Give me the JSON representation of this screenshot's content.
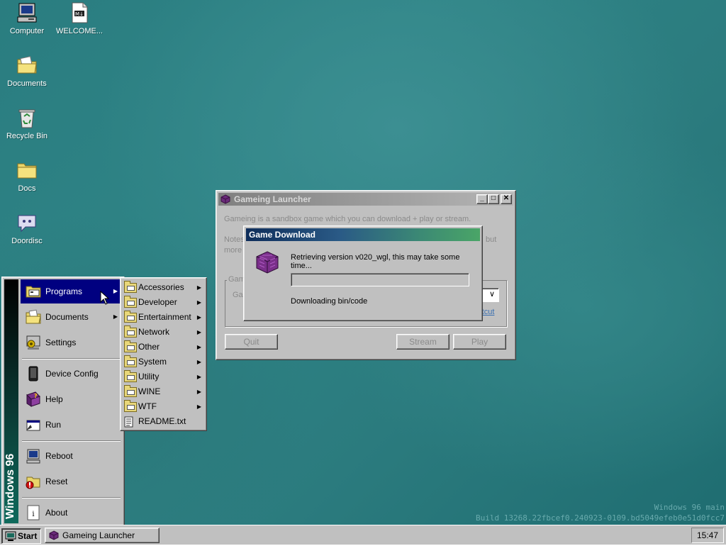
{
  "desktop": {
    "icons": [
      {
        "label": "Computer",
        "icon": "computer-icon"
      },
      {
        "label": "WELCOME...",
        "icon": "markdown-file-icon"
      },
      {
        "label": "Documents",
        "icon": "documents-folder-icon"
      },
      {
        "label": "Recycle Bin",
        "icon": "recycle-bin-icon"
      },
      {
        "label": "Docs",
        "icon": "folder-icon"
      },
      {
        "label": "Doordisc",
        "icon": "doordisc-icon"
      }
    ],
    "watermark": {
      "line1": "Windows 96 main",
      "line2": "Build 13268.22fbcef0.240923-0109.bd5049efeb0e51d0fcc7"
    }
  },
  "launcher": {
    "title": "Gameing Launcher",
    "description": "Gameing is a sandbox game which you can download + play or stream.",
    "notes_prefix": "Notes",
    "notes_suffix": "but",
    "more_prefix": "more",
    "group_label": "Game",
    "version_label": "Ga",
    "shortcut_link": "rtcut",
    "buttons": {
      "quit": "Quit",
      "stream": "Stream",
      "play": "Play"
    }
  },
  "download_dialog": {
    "title": "Game Download",
    "message": "Retrieving version v020_wgl, this may take some time...",
    "status": "Downloading bin/code",
    "progress": 0
  },
  "start_menu": {
    "side_label": "Windows 96",
    "items": [
      {
        "label": "Programs",
        "icon": "programs-icon",
        "submenu": true
      },
      {
        "label": "Documents",
        "icon": "documents-icon",
        "submenu": true
      },
      {
        "label": "Settings",
        "icon": "settings-icon",
        "submenu": false
      },
      {
        "label": "Device Config",
        "icon": "device-config-icon",
        "submenu": false
      },
      {
        "label": "Help",
        "icon": "help-icon",
        "submenu": false
      },
      {
        "label": "Run",
        "icon": "run-icon",
        "submenu": false
      },
      {
        "label": "Reboot",
        "icon": "reboot-icon",
        "submenu": false
      },
      {
        "label": "Reset",
        "icon": "reset-icon",
        "submenu": false
      },
      {
        "label": "About",
        "icon": "about-icon",
        "submenu": false
      }
    ]
  },
  "programs_menu": {
    "items": [
      {
        "label": "Accessories",
        "submenu": true
      },
      {
        "label": "Developer",
        "submenu": true
      },
      {
        "label": "Entertainment",
        "submenu": true
      },
      {
        "label": "Network",
        "submenu": true
      },
      {
        "label": "Other",
        "submenu": true
      },
      {
        "label": "System",
        "submenu": true
      },
      {
        "label": "Utility",
        "submenu": true
      },
      {
        "label": "WINE",
        "submenu": true
      },
      {
        "label": "WTF",
        "submenu": true
      },
      {
        "label": "README.txt",
        "submenu": false
      }
    ]
  },
  "taskbar": {
    "start_label": "Start",
    "task_label": "Gameing Launcher",
    "clock": "15:47"
  },
  "colors": {
    "active_title": "#000080",
    "download_title_start": "#0e2d5a",
    "download_title_end": "#4aa567",
    "desktop": "#2b7f82"
  }
}
